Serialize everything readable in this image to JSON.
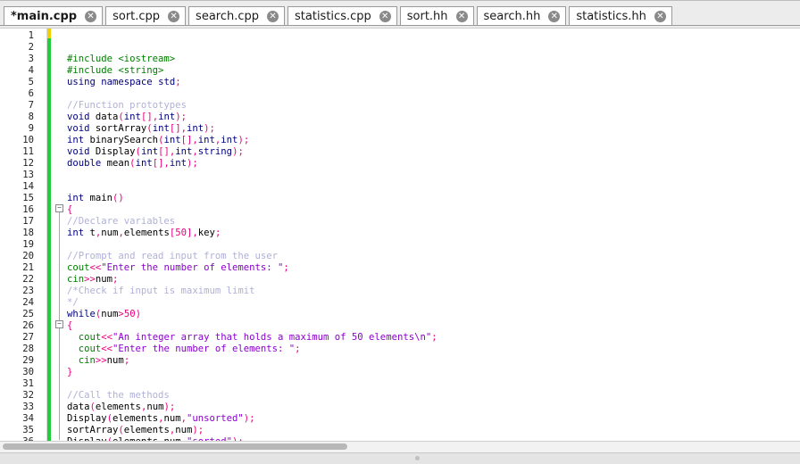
{
  "tabs": [
    {
      "label": "*main.cpp",
      "active": true
    },
    {
      "label": "sort.cpp",
      "active": false
    },
    {
      "label": "search.cpp",
      "active": false
    },
    {
      "label": "statistics.cpp",
      "active": false
    },
    {
      "label": "sort.hh",
      "active": false
    },
    {
      "label": "search.hh",
      "active": false
    },
    {
      "label": "statistics.hh",
      "active": false
    }
  ],
  "close_glyph": "✕",
  "line_numbers": [
    "1",
    "2",
    "3",
    "4",
    "5",
    "6",
    "7",
    "8",
    "9",
    "10",
    "11",
    "12",
    "13",
    "14",
    "15",
    "16",
    "17",
    "18",
    "19",
    "20",
    "21",
    "22",
    "23",
    "24",
    "25",
    "26",
    "27",
    "28",
    "29",
    "30",
    "31",
    "32",
    "33",
    "34",
    "35",
    "36"
  ],
  "code_lines": [
    "",
    "",
    "#include <iostream>",
    "#include <string>",
    "using namespace std;",
    "",
    "//Function prototypes",
    "void data(int[],int);",
    "void sortArray(int[],int);",
    "int binarySearch(int[],int,int);",
    "void Display(int[],int,string);",
    "double mean(int[],int);",
    "",
    "",
    "int main()",
    "{",
    "//Declare variables",
    "int t,num,elements[50],key;",
    "",
    "//Prompt and read input from the user",
    "cout<<\"Enter the number of elements: \";",
    "cin>>num;",
    "/*Check if input is maximum limit",
    "*/",
    "while(num>50)",
    "{",
    "  cout<<\"An integer array that holds a maximum of 50 elements\\n\";",
    "  cout<<\"Enter the number of elements: \";",
    "  cin>>num;",
    "}",
    "",
    "//Call the methods",
    "data(elements,num);",
    "Display(elements,num,\"unsorted\");",
    "sortArray(elements,num);",
    "Display(elements,num,\"sorted\");"
  ],
  "colors": {
    "keyword": "#000080",
    "preprocessor": "#008000",
    "comment": "#b0b0d8",
    "string": "#8b00cc",
    "number": "#e8007c",
    "change_marker": "#1fce3b",
    "unsaved_marker": "#f0d000"
  },
  "icons": {
    "close": "close-icon",
    "fold": "fold-toggle-icon"
  }
}
